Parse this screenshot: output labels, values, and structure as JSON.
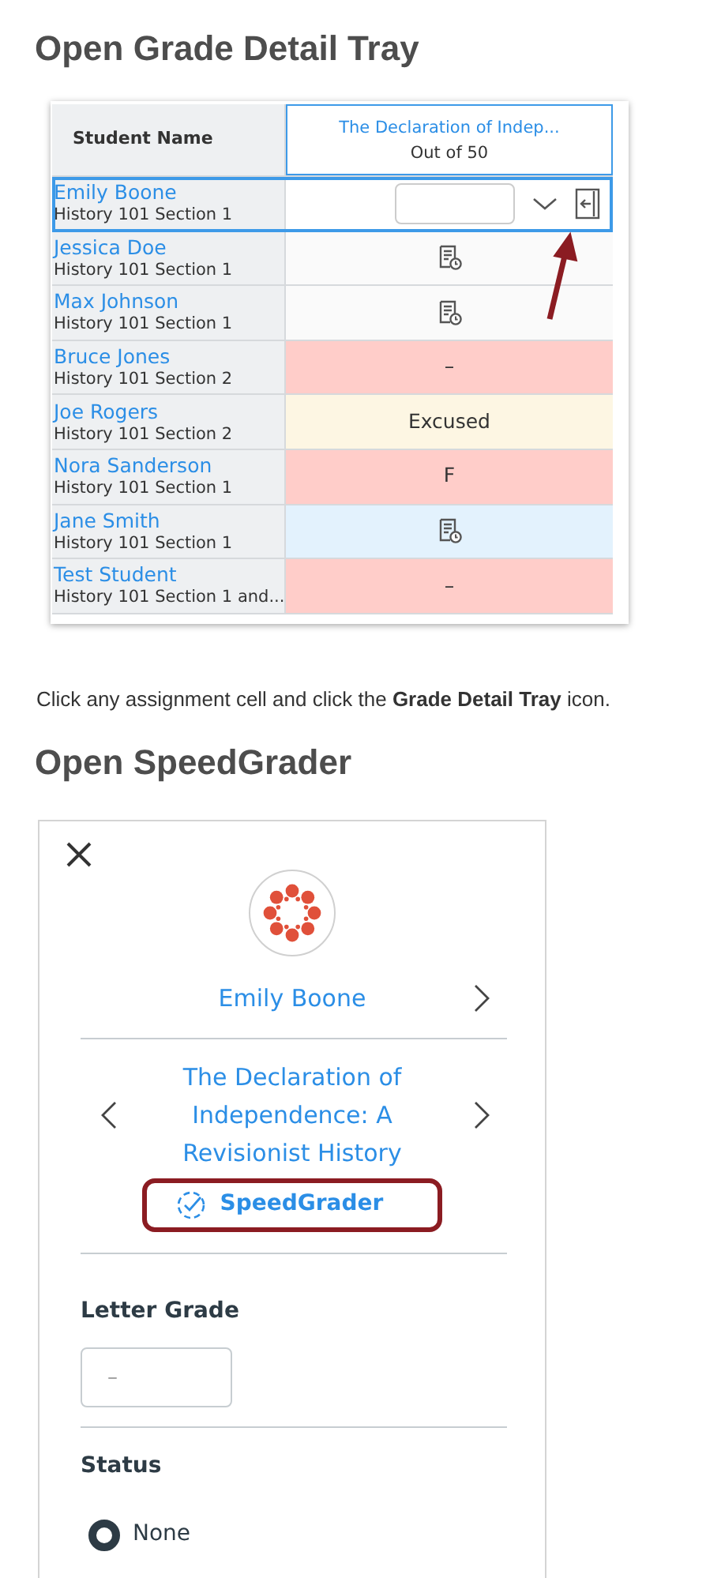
{
  "sections": [
    {
      "heading": "Open Grade Detail Tray"
    },
    {
      "heading": "Open SpeedGrader"
    }
  ],
  "gradebook": {
    "columns": [
      {
        "title": "Student Name"
      },
      {
        "title": "The Declaration of Indep...",
        "subtitle": "Out of 50"
      }
    ],
    "rows": [
      {
        "name": "Emily Boone",
        "section": "History 101 Section 1",
        "selected": true,
        "cell": {
          "kind": "editor",
          "color": "#ffffff"
        }
      },
      {
        "name": "Jessica Doe",
        "section": "History 101 Section 1",
        "selected": false,
        "cell": {
          "kind": "icon",
          "color": "#fafafa"
        }
      },
      {
        "name": "Max Johnson",
        "section": "History 101 Section 1",
        "selected": false,
        "cell": {
          "kind": "icon",
          "color": "#fafafa"
        }
      },
      {
        "name": "Bruce Jones",
        "section": "History 101 Section 2",
        "selected": false,
        "cell": {
          "kind": "text",
          "text": "–",
          "color": "#ffcdc9"
        }
      },
      {
        "name": "Joe Rogers",
        "section": "History 101 Section 2",
        "selected": false,
        "cell": {
          "kind": "text",
          "text": "Excused",
          "color": "#fdf6e3"
        }
      },
      {
        "name": "Nora Sanderson",
        "section": "History 101 Section 1",
        "selected": false,
        "cell": {
          "kind": "text",
          "text": "F",
          "color": "#ffcdc9"
        }
      },
      {
        "name": "Jane Smith",
        "section": "History 101 Section 1",
        "selected": false,
        "cell": {
          "kind": "icon",
          "color": "#e3f2fd"
        }
      },
      {
        "name": "Test Student",
        "section": "History 101 Section 1 and...",
        "selected": false,
        "cell": {
          "kind": "text",
          "text": "–",
          "color": "#ffcdc9"
        }
      }
    ]
  },
  "caption": "Click any assignment cell and click the **Grade Detail Tray** icon.",
  "tray": {
    "student": "Emily Boone",
    "assignment": "The Declaration of Independence: A Revisionist History",
    "speedgrader": {
      "label": "SpeedGrader",
      "highlighted": true
    },
    "grade": {
      "label": "Letter Grade",
      "placeholder": "–"
    },
    "status": {
      "label": "Status",
      "options": [
        {
          "label": "None",
          "selected": true
        }
      ]
    }
  }
}
